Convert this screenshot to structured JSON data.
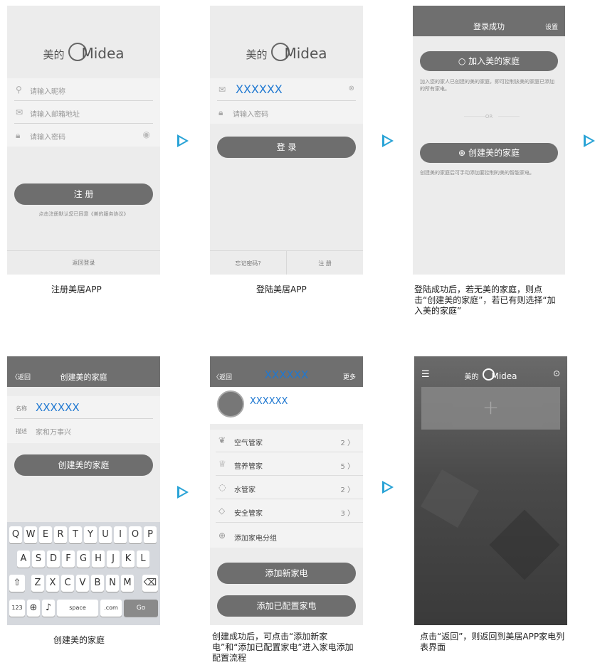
{
  "colors": {
    "accent": "#29a3d6",
    "pill": "#6e6e6e",
    "topbar": "#6f6f6f",
    "screen": "#ececec"
  },
  "logo": {
    "cn": "美的",
    "en": "Midea"
  },
  "register": {
    "nickname": "请输入昵称",
    "email": "请输入邮箱地址",
    "password": "请输入密码",
    "submit": "注 册",
    "agreement": "点击注册默认您已同意《美的服务协议》",
    "back_login": "返回登录",
    "caption": "注册美居APP"
  },
  "login": {
    "account": "XXXXXX",
    "password": "请输入密码",
    "submit": "登 录",
    "forgot": "忘记密码?",
    "register": "注 册",
    "caption": "登陆美居APP"
  },
  "success": {
    "title": "登录成功",
    "settings": "设置",
    "join": "加入美的家庭",
    "join_desc": "加入您的家人已创建的美的家庭，即可控制该美的家庭已添加的所有家电。",
    "or": "OR",
    "create": "创建美的家庭",
    "create_desc": "创建美的家庭后可手动添加要控制的美的智能家电。",
    "caption": "登陆成功后，若无美的家庭，则点击“创建美的家庭”，若已有则选择“加入美的家庭”"
  },
  "create_home": {
    "back": "返回",
    "title": "创建美的家庭",
    "name_label": "名称",
    "name_value": "XXXXXX",
    "desc_label": "描述",
    "desc_value": "家和万事兴",
    "submit": "创建美的家庭",
    "caption": "创建美的家庭",
    "keyboard": {
      "row1": [
        "Q",
        "W",
        "E",
        "R",
        "T",
        "Y",
        "U",
        "I",
        "O",
        "P"
      ],
      "row2": [
        "A",
        "S",
        "D",
        "F",
        "G",
        "H",
        "J",
        "K",
        "L"
      ],
      "row3": [
        "Z",
        "X",
        "C",
        "V",
        "B",
        "N",
        "M"
      ],
      "num": "123",
      "space": "space",
      "com": ".com",
      "go": "Go"
    }
  },
  "home_detail": {
    "back": "返回",
    "title": "XXXXXX",
    "more": "更多",
    "user": "XXXXXX",
    "groups": [
      {
        "name": "空气管家",
        "count": "2",
        "icon": "leaf-icon"
      },
      {
        "name": "营养管家",
        "count": "5",
        "icon": "chef-hat-icon"
      },
      {
        "name": "水管家",
        "count": "2",
        "icon": "water-drop-icon"
      },
      {
        "name": "安全管家",
        "count": "3",
        "icon": "shield-icon"
      }
    ],
    "add_group": "添加家电分组",
    "add_new": "添加新家电",
    "add_configured": "添加已配置家电",
    "caption": "创建成功后，可点击“添加新家电”和“添加已配置家电”进入家电添加配置流程"
  },
  "appliance_list": {
    "caption": "点击“返回”，则返回到美居APP家电列表界面"
  }
}
